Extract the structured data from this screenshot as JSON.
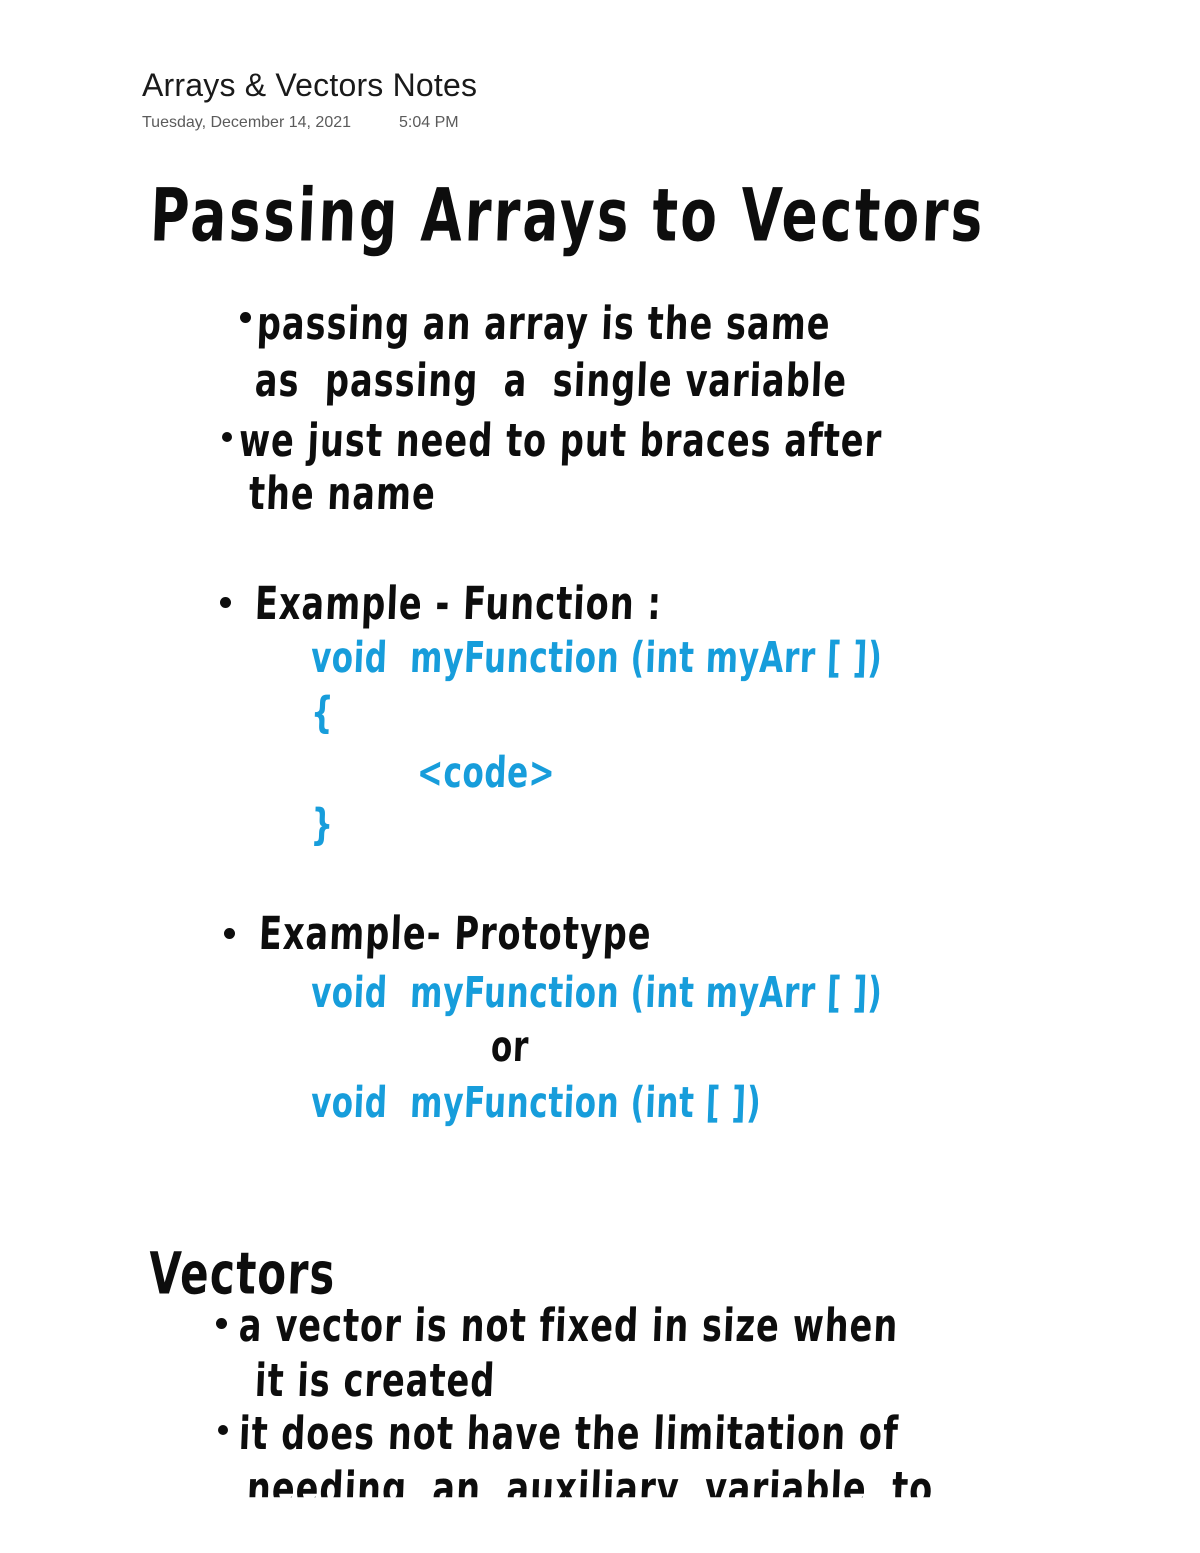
{
  "header": {
    "title": "Arrays & Vectors Notes",
    "date": "Tuesday, December 14, 2021",
    "time": "5:04 PM",
    "title_color": "#1a1a1a",
    "meta_color": "#5b5b5b"
  },
  "ink_colors": {
    "black": "#0d0d0d",
    "blue": "#179DDB"
  },
  "notes": {
    "heading_main": "Passing Arrays to Vectors",
    "bullets_intro": [
      {
        "line1": "passing an array is the same",
        "line2": "as  passing  a  single variable"
      },
      {
        "line1": "we just need to put braces after",
        "line2": "the name"
      }
    ],
    "example_function": {
      "label": "Example - Function :",
      "code": [
        "void  myFunction (int myArr [ ])",
        "{",
        "<code>",
        "}"
      ]
    },
    "example_prototype": {
      "label": "Example- Prototype",
      "code_line_1": "void  myFunction (int myArr [ ])",
      "separator": "or",
      "code_line_2": "void  myFunction (int [ ])"
    },
    "heading_vectors": "Vectors",
    "bullets_vectors": [
      {
        "line1": "a vector is not fixed in size when",
        "line2": "it is created"
      },
      {
        "line1": "it does not have the limitation of",
        "line2": "needing  an  auxiliary  variable  to"
      }
    ]
  }
}
